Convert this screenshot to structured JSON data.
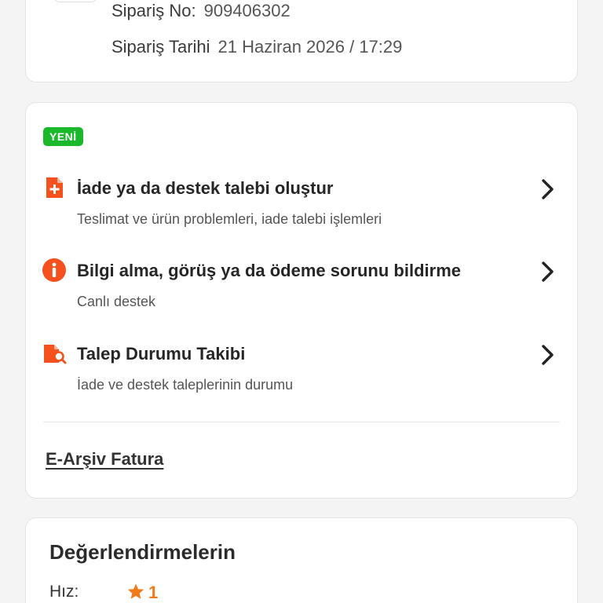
{
  "order": {
    "no_label": "Sipariş No:",
    "no_value": "909406302",
    "date_label": "Sipariş Tarihi",
    "date_value": "21 Haziran 2026 / 17:29"
  },
  "support": {
    "badge": "YENİ",
    "items": [
      {
        "title": "İade ya da destek talebi oluştur",
        "subtitle": "Teslimat ve ürün problemleri, iade talebi işlemleri",
        "icon": "document-plus-icon"
      },
      {
        "title": "Bilgi alma, görüş ya da ödeme sorunu bildirme",
        "subtitle": "Canlı destek",
        "icon": "info-icon"
      },
      {
        "title": "Talep Durumu Takibi",
        "subtitle": "İade ve destek taleplerinin durumu",
        "icon": "document-search-icon"
      }
    ],
    "earsiv_label": "E-Arşiv Fatura"
  },
  "reviews": {
    "title": "Değerlendirmelerin",
    "speed_label": "Hız:",
    "speed_score": "1"
  },
  "colors": {
    "accent": "#f27a1a",
    "icon_orange": "#f4511e",
    "badge_green": "#1ab82b"
  }
}
